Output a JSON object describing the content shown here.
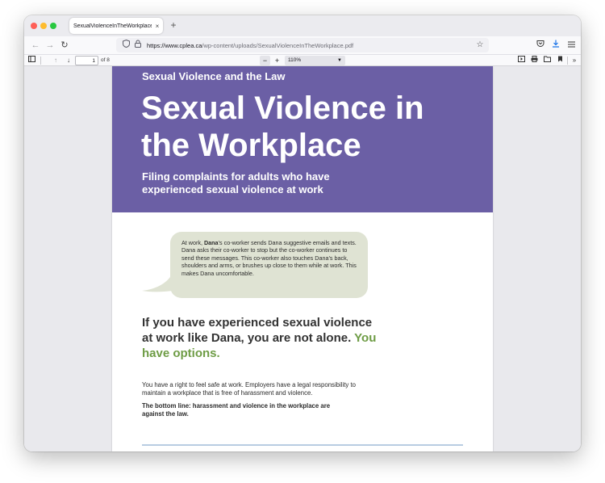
{
  "browser": {
    "tab_title": "SexualViolenceInTheWorkplace.pdf",
    "tab_close": "×",
    "new_tab": "+",
    "url_domain": "https://www.cplea.ca",
    "url_path": "/wp-content/uploads/SexualViolenceInTheWorkplace.pdf"
  },
  "pdf_toolbar": {
    "page_number": "1",
    "page_total": "of 8",
    "zoom_value": "110%"
  },
  "document": {
    "kicker": "Sexual Violence and the Law",
    "title": "Sexual Violence in the Workplace",
    "subtitle": "Filing complaints for adults who have experienced sexual violence at work",
    "bubble_name": "Dana",
    "bubble_text": "’s co-worker sends Dana suggestive emails and texts. Dana asks their co-worker to stop but the co-worker continues to send these messages. This co-worker also touches Dana’s back, shoulders and arms, or brushes up close to them while at work. This makes Dana uncomfortable.",
    "bubble_prefix": "At work, ",
    "heading_main": "If you have experienced sexual violence at work like Dana, you are not alone.",
    "heading_accent": "You have options.",
    "paragraph": "You have a right to feel safe at work. Employers have a legal responsibility to maintain a workplace that is free of harassment and violence.",
    "bold_paragraph": "The bottom line: harassment and violence in the workplace are against the law."
  },
  "colors": {
    "banner": "#6b5fa5",
    "bubble": "#dfe3d3",
    "accent_green": "#6e9c45",
    "rule": "#b9cde2"
  },
  "icons": [
    "back-arrow-icon",
    "forward-arrow-icon",
    "reload-icon",
    "shield-icon",
    "lock-icon",
    "star-icon",
    "pocket-icon",
    "download-icon",
    "menu-icon",
    "sidebar-toggle-icon",
    "previous-page-icon",
    "next-page-icon",
    "zoom-out-icon",
    "zoom-in-icon",
    "presentation-icon",
    "print-icon",
    "save-icon",
    "bookmark-icon",
    "more-tools-icon"
  ]
}
